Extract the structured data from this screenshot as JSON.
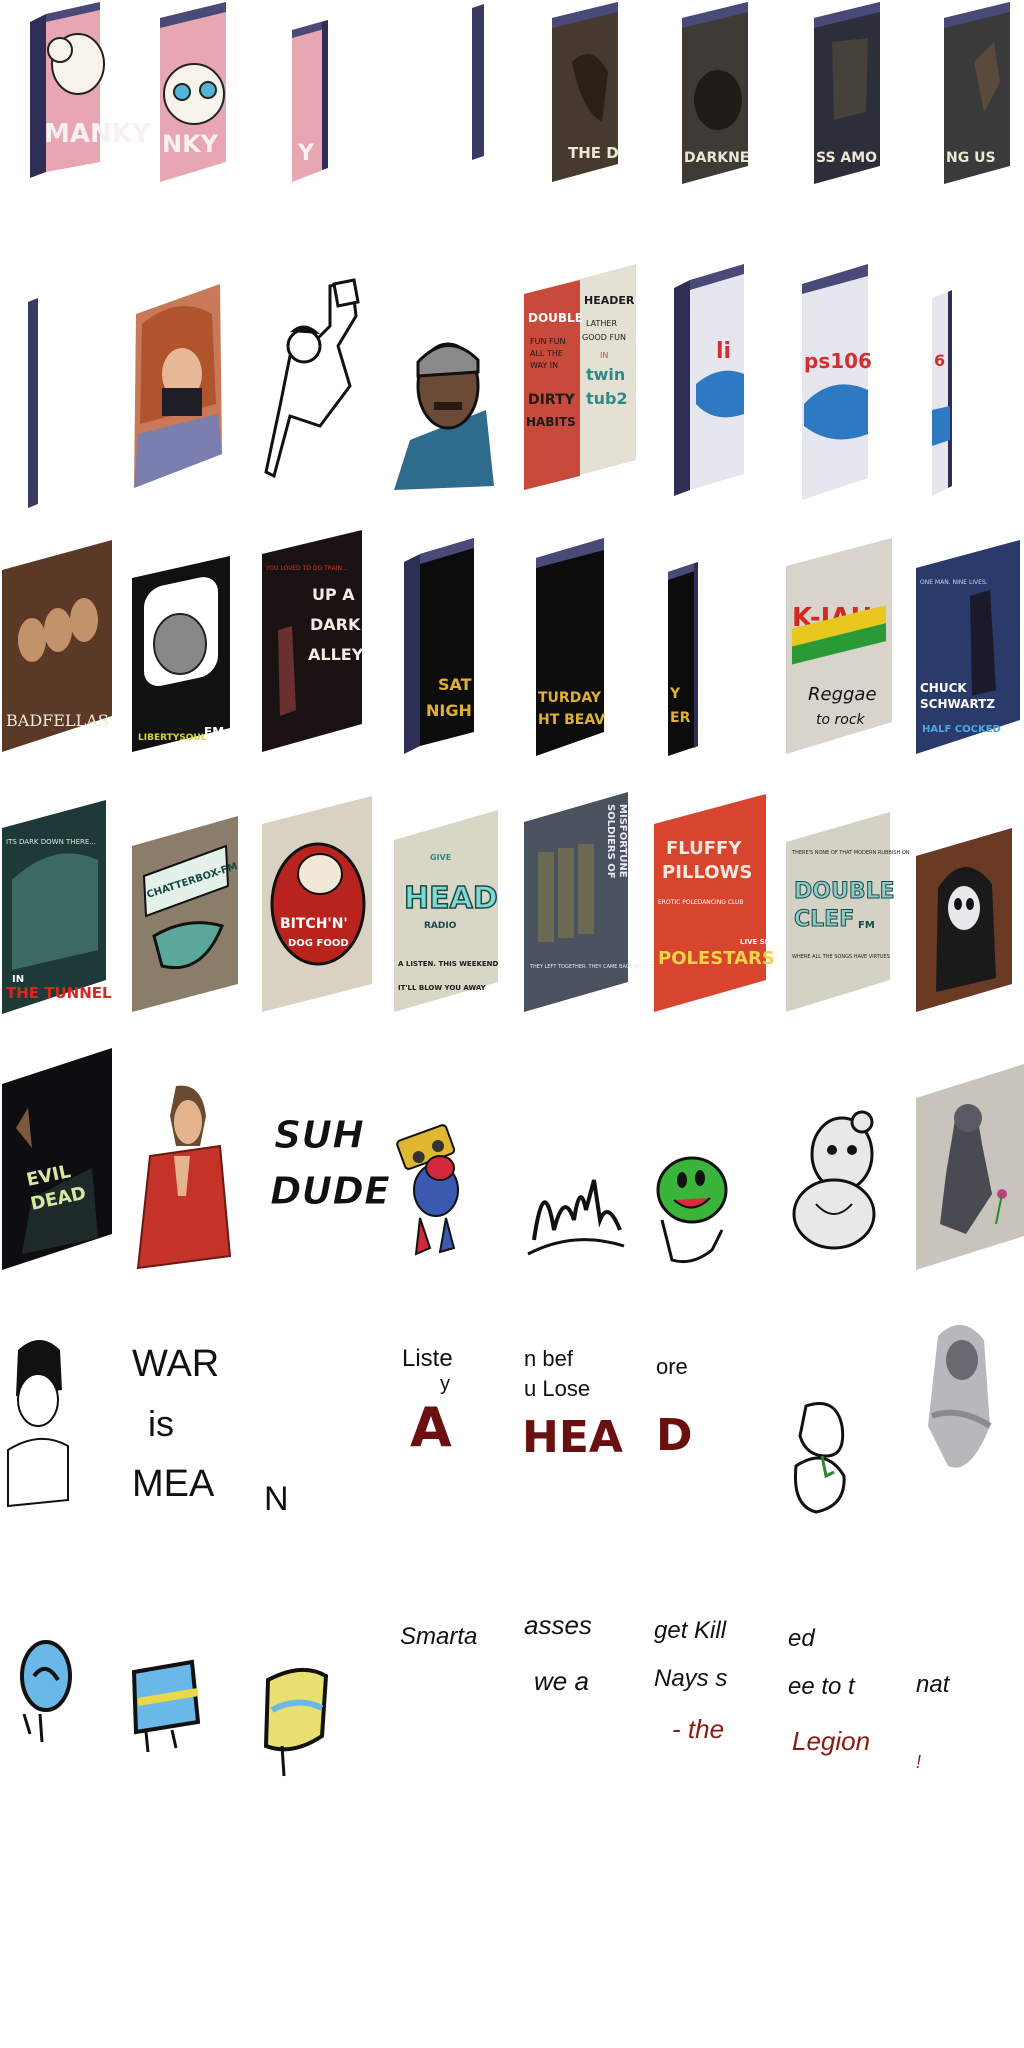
{
  "sheet": {
    "background": "#ffffff",
    "frame_color": "#4a4a78",
    "frame_side": "#2f2f55"
  },
  "row1": {
    "manky_1": "MANKY",
    "manky_2": "NKY",
    "manky_3": "Y",
    "darkness_1": "THE D",
    "darkness_2": "DARKNE",
    "darkness_3": "SS AMO",
    "darkness_4": "NG US"
  },
  "row2": {
    "double_1": "DOUBLE",
    "double_2": "FUN FUN",
    "double_3": "ALL THE",
    "double_4": "WAY IN",
    "double_5": "DIRTY",
    "double_6": "HABITS",
    "header_1": "HEADER",
    "header_2": "LATHER",
    "header_3": "GOOD FUN",
    "header_4": "IN",
    "header_5": "twin",
    "header_6": "tub2",
    "lips_1": "li",
    "lips_2": "ps106",
    "lips_3": "6"
  },
  "row3": {
    "badfellas": "BADFELLAS",
    "libertysoul": "LIBERTYSOUL",
    "libertysoul_fm": "FM",
    "alley_tag": "YOU LOVED TO DO TRAIN...",
    "alley_1": "UP A",
    "alley_2": "DARK",
    "alley_3": "ALLEY",
    "saturday_1": "SAT",
    "saturday_2": "NIGH",
    "saturday_3": "TURDAY",
    "saturday_4": "HT BEAV",
    "saturday_5": "Y",
    "saturday_6": "ER",
    "k_jah": "K-JAH",
    "reggae": "Reggae",
    "to_rock": "to rock",
    "chuck_top": "ONE MAN. NINE LIVES.",
    "chuck_1": "CHUCK",
    "chuck_2": "SCHWARTZ",
    "chuck_3": "HALF COCKED"
  },
  "row4": {
    "tunnel_top": "ITS DARK DOWN THERE...",
    "tunnel_in": "IN",
    "tunnel_title": "THE TUNNEL",
    "chatterbox": "CHATTERBOX-FM",
    "bitch_1": "BITCH'N'",
    "bitch_2": "DOG FOOD",
    "give": "GIVE",
    "head": "HEAD",
    "radio": "RADIO",
    "head_sub_1": "A LISTEN. THIS WEEKEND",
    "head_sub_2": "IT'LL BLOW YOU AWAY",
    "soldiers_1": "SOLDIERS OF",
    "soldiers_2": "MISFORTUNE",
    "soldiers_sub": "THEY LEFT TOGETHER. THEY CAME BACK IN PIECES.",
    "fluffy_1": "FLUFFY",
    "fluffy_2": "PILLOWS",
    "fluffy_3": "EROTIC POLEDANCING CLUB",
    "fluffy_4": "POLESTARS",
    "fluffy_5": "LIVE SHOW",
    "double_clef_top": "THERE'S NONE OF THAT MODERN RUBBISH ON",
    "double_clef_1": "DOUBLE",
    "double_clef_2": "CLEF",
    "double_clef_fm": "FM",
    "double_clef_sub": "WHERE ALL THE SONGS HAVE VIRTUES"
  },
  "row5": {
    "evil_1": "EVIL",
    "evil_2": "DEAD",
    "suh_dude_1": "SUH",
    "suh_dude_2": "DUDE"
  },
  "row6": {
    "war_1": "WAR",
    "war_2": "is",
    "war_3": "MEA",
    "n_fragment": "N",
    "listen_1": "Liste",
    "listen_2": "y",
    "listen_3": "A",
    "before_1": "n bef",
    "before_2": "u Lose",
    "before_3": "HEA",
    "more_1": "ore",
    "more_2": "D"
  },
  "row7": {
    "smart": "Smarta",
    "asses_1": "asses",
    "asses_2": "we a",
    "kill_1": "get Kill",
    "kill_2": "Nays s",
    "kill_3": "- the",
    "legion_1": "ed",
    "legion_2": "ee to t",
    "legion_3": "Legion",
    "that_1": "nat",
    "that_2": "!"
  }
}
